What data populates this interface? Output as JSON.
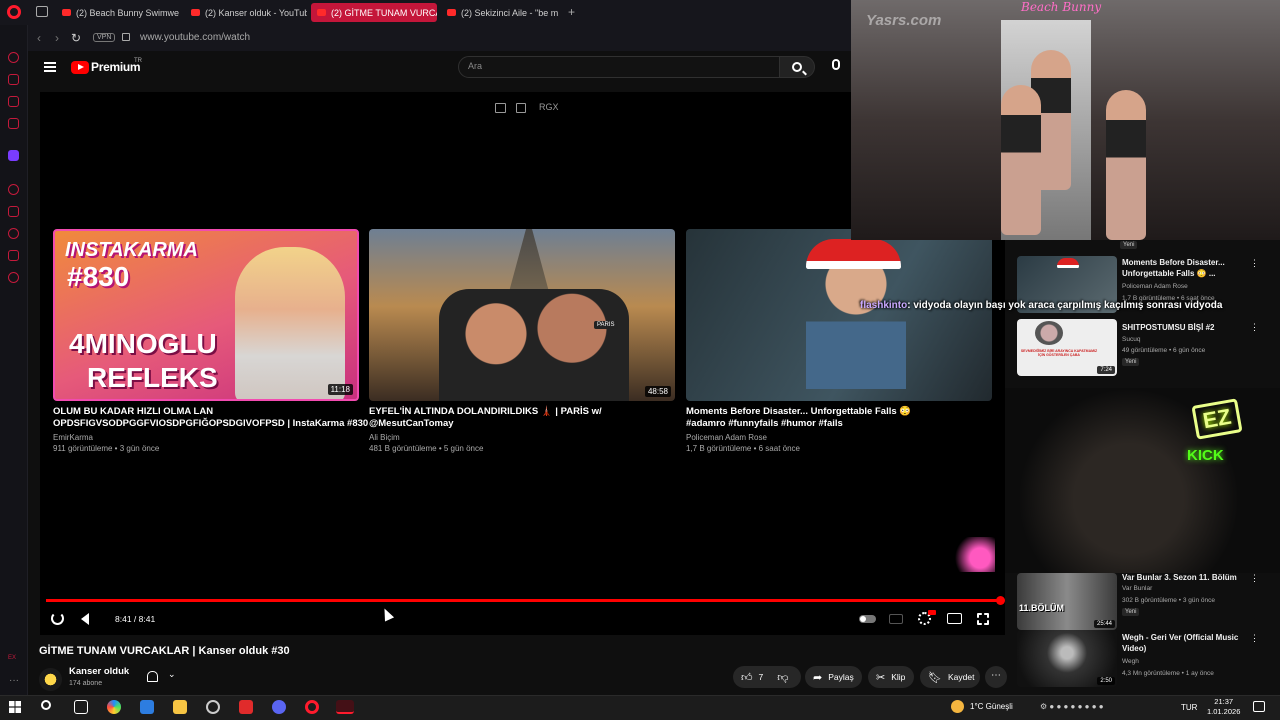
{
  "browser": {
    "tabs": [
      {
        "label": "(2) Beach Bunny Swimwe"
      },
      {
        "label": "(2) Kanser olduk - YouTub"
      },
      {
        "label": "(2) GİTME TUNAM VURCA"
      },
      {
        "label": "(2) Sekizinci Aile - \"be m"
      }
    ],
    "active_tab_index": 2,
    "vpn_label": "VPN",
    "url": "www.youtube.com/watch"
  },
  "youtube": {
    "brand": "Premium",
    "brand_region": "TR",
    "search_placeholder": "Ara",
    "overlay_label": "RGX"
  },
  "endscreen": [
    {
      "thumb_title": "INSTAKARMA",
      "thumb_number": "#830",
      "thumb_text_1": "4MINOGLU",
      "thumb_text_2": "REFLEKS",
      "duration": "11:18",
      "title": "OLUM BU KADAR HIZLI OLMA LAN OPDSFIGVSODPGGFVIOSDPGFIĞOPSDGIVOFPSD | InstaKarma #830",
      "channel": "EmirKarma",
      "meta": "911 görüntüleme • 3 gün önce"
    },
    {
      "thumb_badge": "PARIS",
      "duration": "48:58",
      "title": "EYFEL'İN ALTINDA DOLANDIRILDIKS 🗼 | PARİS w/ @MesutCanTomay",
      "channel": "Ali Biçim",
      "meta": "481 B görüntüleme • 5 gün önce"
    },
    {
      "title": "Moments Before Disaster... Unforgettable Falls 😳 #adamro #funnyfails #humor #fails",
      "channel": "Policeman Adam Rose",
      "meta": "1,7 B görüntüleme • 6 saat önce"
    }
  ],
  "player": {
    "time": "8:41 / 8:41",
    "progress": 1.0
  },
  "video": {
    "title": "GİTME TUNAM VURCAKLAR | Kanser olduk #30",
    "channel": "Kanser olduk",
    "subscribers": "174 abone",
    "avatar_text": "KANSER OLDUK",
    "likes": "7",
    "share": "Paylaş",
    "clip": "Klip",
    "save": "Kaydet"
  },
  "stream": {
    "overlay_logo": "Beach Bunny",
    "watermark": "Yasrs.com",
    "chat_user": "flashkinto",
    "chat_message": ": vidyoda olayın başı yok araca çarpılmış kaçılmış sonrası vidyoda",
    "ez_label": "EZ",
    "kick_label": "KICK"
  },
  "related_top": [
    {
      "title": "Moments Before Disaster... Unforgettable Falls 😳 ...",
      "channel": "Policeman Adam Rose",
      "meta": "1,7 B görüntüleme • 6 saat önce",
      "badge": "Yeni"
    },
    {
      "title": "SHITPOSTUMSU BİŞİ #2",
      "channel": "Sucuq",
      "meta": "49 görüntüleme • 6 gün önce",
      "badge": "Yeni",
      "duration": "7:24",
      "thumb_caption": "SEVMEDİĞİMİZ BİRİ ARAYINCA KAPATMAMIZ İÇİN GÖSTERİLEN ÇABA"
    }
  ],
  "related_top_badge": "Yeni",
  "related_bottom": [
    {
      "title": "Var Bunlar 3. Sezon 11. Bölüm",
      "channel": "Var Bunlar",
      "meta": "302 B görüntüleme • 3 gün önce",
      "badge": "Yeni",
      "duration": "25:44",
      "thumb_text": "11.BÖLÜM"
    },
    {
      "title": "Wegh - Geri Ver (Official Music Video)",
      "channel": "Wegh",
      "meta": "4,3 Mn görüntüleme • 1 ay önce",
      "duration": "2:50"
    }
  ],
  "taskbar": {
    "weather": "1°C  Güneşli",
    "language": "TUR",
    "time": "21:37",
    "date": "1.01.2026"
  },
  "colors": {
    "accent": "#ff0000",
    "opera": "#ff1b2d",
    "active_tab": "#c4163a",
    "chat_user": "#c9a8ff",
    "kick": "#53fc18"
  }
}
